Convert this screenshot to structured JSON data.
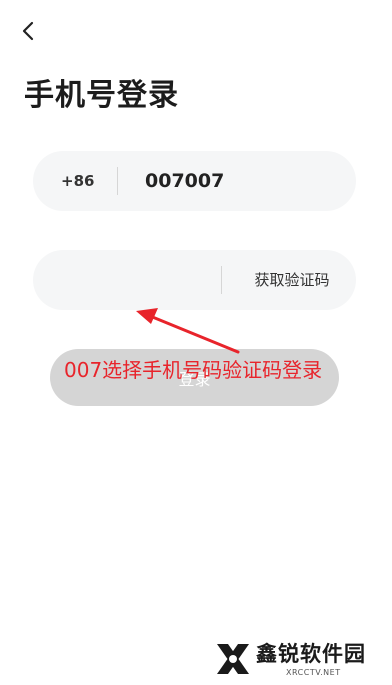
{
  "header": {
    "back_icon": "chevron-left-icon",
    "title": "手机号登录"
  },
  "phone_field": {
    "country_code": "+86",
    "value": "007007"
  },
  "code_field": {
    "value": "",
    "get_code_label": "获取验证码"
  },
  "login_button": {
    "label": "登录"
  },
  "annotation": {
    "text": "007选择手机号码验证码登录",
    "color": "#e8242b"
  },
  "watermark": {
    "name": "鑫锐软件园",
    "url": "XRCCTV.NET"
  }
}
